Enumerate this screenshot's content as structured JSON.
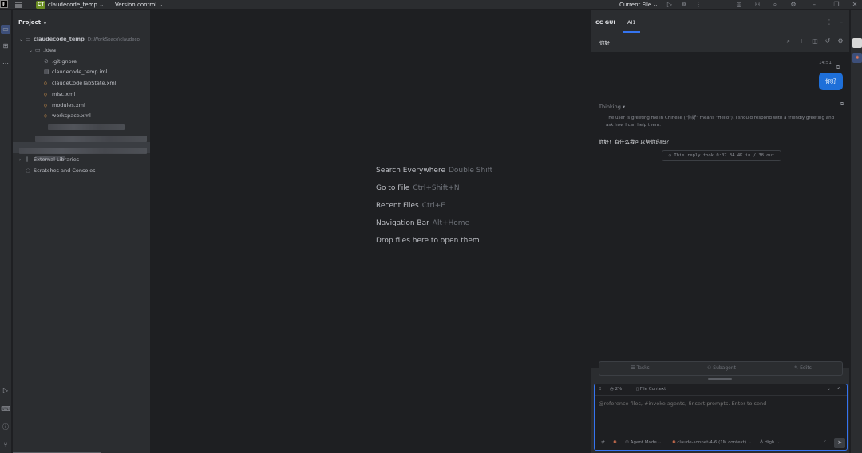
{
  "titlebar": {
    "logo": "IJ",
    "project_badge": "CT",
    "project_name": "claudecode_temp",
    "vcs_label": "Version control",
    "run_config": "Current File"
  },
  "project_panel": {
    "title": "Project",
    "tree": [
      {
        "label": "claudecode_temp",
        "path": "D:\\WorkSpace\\claudeco",
        "icon": "folder-icon",
        "level": 0,
        "expanded": true,
        "bold": true
      },
      {
        "label": ".idea",
        "icon": "folder-icon",
        "level": 1,
        "expanded": true
      },
      {
        "label": ".gitignore",
        "icon": "ignore-file-icon",
        "level": 2
      },
      {
        "label": "claudecode_temp.iml",
        "icon": "iml-file-icon",
        "level": 2
      },
      {
        "label": "claudeCodeTabState.xml",
        "icon": "xml-file-icon",
        "level": 2
      },
      {
        "label": "misc.xml",
        "icon": "xml-file-icon",
        "level": 2
      },
      {
        "label": "modules.xml",
        "icon": "xml-file-icon",
        "level": 2
      },
      {
        "label": "workspace.xml",
        "icon": "xml-file-icon",
        "level": 2
      },
      {
        "label": "External Libraries",
        "icon": "library-icon",
        "level": 0,
        "expanded": false
      },
      {
        "label": "Scratches and Consoles",
        "icon": "scratch-icon",
        "level": 0
      }
    ]
  },
  "editor": {
    "hints": [
      {
        "action": "Search Everywhere",
        "shortcut": "Double Shift"
      },
      {
        "action": "Go to File",
        "shortcut": "Ctrl+Shift+N"
      },
      {
        "action": "Recent Files",
        "shortcut": "Ctrl+E"
      },
      {
        "action": "Navigation Bar",
        "shortcut": "Alt+Home"
      },
      {
        "action": "Drop files here to open them",
        "shortcut": ""
      }
    ]
  },
  "right_panel": {
    "tabs": [
      "CC GUI",
      "AI1"
    ],
    "active_tab": "AI1",
    "chat_title": "你好",
    "messages": {
      "user_time": "14:51",
      "user_text": "你好",
      "thinking_label": "Thinking",
      "thinking_text": "The user is greeting me in Chinese (\"你好\" means \"Hello\"). I should respond with a friendly greeting and ask how I can help them.",
      "reply_text": "你好！有什么我可以帮你的吗？",
      "reply_meta": "This reply took 0:07  34.4K in / 38 out"
    },
    "action_tabs": [
      "Tasks",
      "Subagent",
      "Edits"
    ],
    "input": {
      "context_percent": "2%",
      "file_context": "File Context",
      "placeholder": "@reference files, #invoke agents, !insert prompts. Enter to send",
      "agent_mode": "Agent Mode",
      "model": "claude-sonnet-4-6 (1M context)",
      "effort": "High"
    }
  },
  "colors": {
    "accent": "#3574f0",
    "user_bubble": "#1e6fd9",
    "project_badge": "#6b8e23"
  }
}
